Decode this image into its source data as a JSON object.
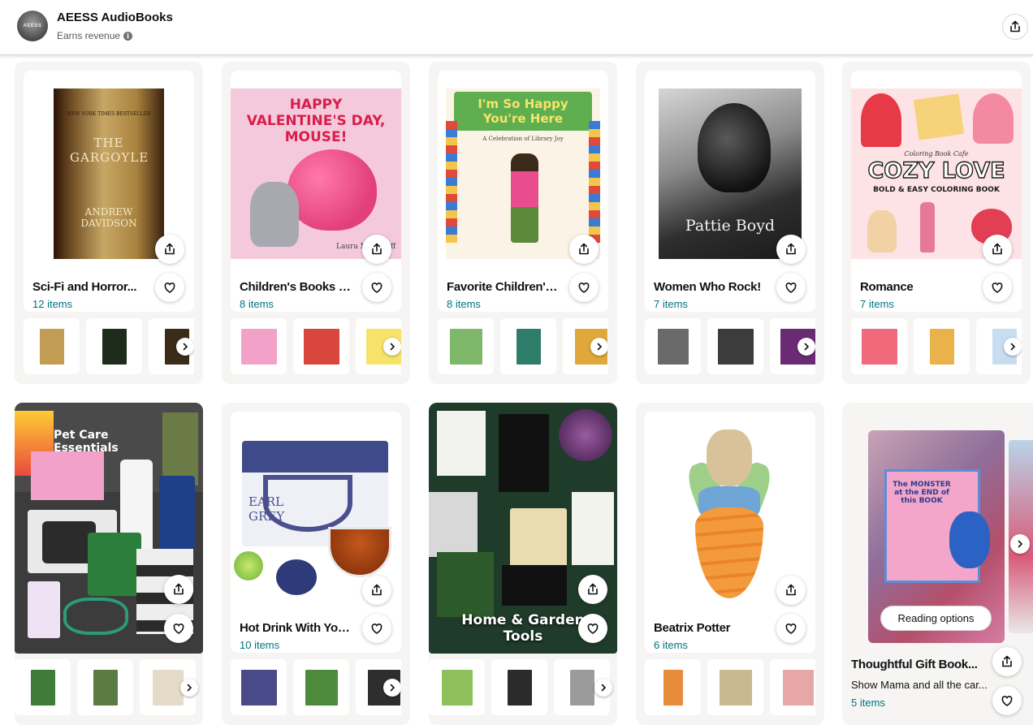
{
  "header": {
    "store_name": "AEESS AudioBooks",
    "revenue_label": "Earns revenue",
    "avatar_text": "AEESS",
    "info_icon": "i"
  },
  "cards": [
    {
      "title": "Sci-Fi and Horror...",
      "count": "12 items",
      "cover_title": "THE GARGOYLE",
      "cover_author": "ANDREW DAVIDSON",
      "cover_top": "NEW YORK TIMES BESTSELLER",
      "thumb_colors": [
        "#c29c52",
        "#1d2c1b",
        "#3a2c18"
      ]
    },
    {
      "title": "Children's Books fo...",
      "count": "8 items",
      "cover_title": "HAPPY VALENTINE'S DAY, MOUSE!",
      "cover_author": "Laura Numeroff",
      "thumb_colors": [
        "#f2a1c8",
        "#d9463b",
        "#f6e36a"
      ]
    },
    {
      "title": "Favorite Children's...",
      "count": "8 items",
      "cover_title": "I'm So Happy You're Here",
      "cover_subtitle": "A Celebration of Library Joy",
      "thumb_colors": [
        "#7fb86a",
        "#2e7d6a",
        "#e0a83a"
      ]
    },
    {
      "title": "Women Who Rock!",
      "count": "7 items",
      "cover_title": "Pattie Boyd",
      "thumb_colors": [
        "#6a6a6a",
        "#3c3c3c",
        "#6b2a74"
      ]
    },
    {
      "title": "Romance",
      "count": "7 items",
      "cover_title": "COZY LOVE",
      "cover_top": "Coloring Book Cafe",
      "cover_subtitle": "BOLD & EASY COLORING BOOK",
      "thumb_colors": [
        "#f06a7c",
        "#e9b24a",
        "#c8ddf2"
      ]
    },
    {
      "title": "Pet Care Essentials",
      "overlay_title": "Pet Care Essentials",
      "thumb_colors": [
        "#3f7b3a",
        "#5a7b43",
        "#e4dcc8"
      ]
    },
    {
      "title": "Hot Drink With You...",
      "count": "10 items",
      "cover_title": "EARL GREY",
      "thumb_colors": [
        "#494a8a",
        "#4d8a3b",
        "#2e2e2e"
      ]
    },
    {
      "title": "Home & Garden Tools",
      "overlay_title": "Home & Garden Tools",
      "thumb_colors": [
        "#8dbf5b",
        "#2b2b2b",
        "#9b9b9b"
      ]
    },
    {
      "title": "Beatrix Potter",
      "count": "6 items",
      "thumb_colors": [
        "#e68c3a",
        "#c9b890",
        "#e8a7a7"
      ]
    },
    {
      "title": "Thoughtful Gift Book...",
      "description": "Show Mama and all the car...",
      "count": "5 items",
      "reading_options": "Reading options",
      "cover_title": "The MONSTER at the END of this BOOK"
    }
  ],
  "colors": {
    "link": "#007185",
    "card_bg": "#f6f5f3",
    "border": "#d5d9d9"
  },
  "icons": [
    "share-icon",
    "heart-icon",
    "chevron-right-icon",
    "info-icon"
  ]
}
